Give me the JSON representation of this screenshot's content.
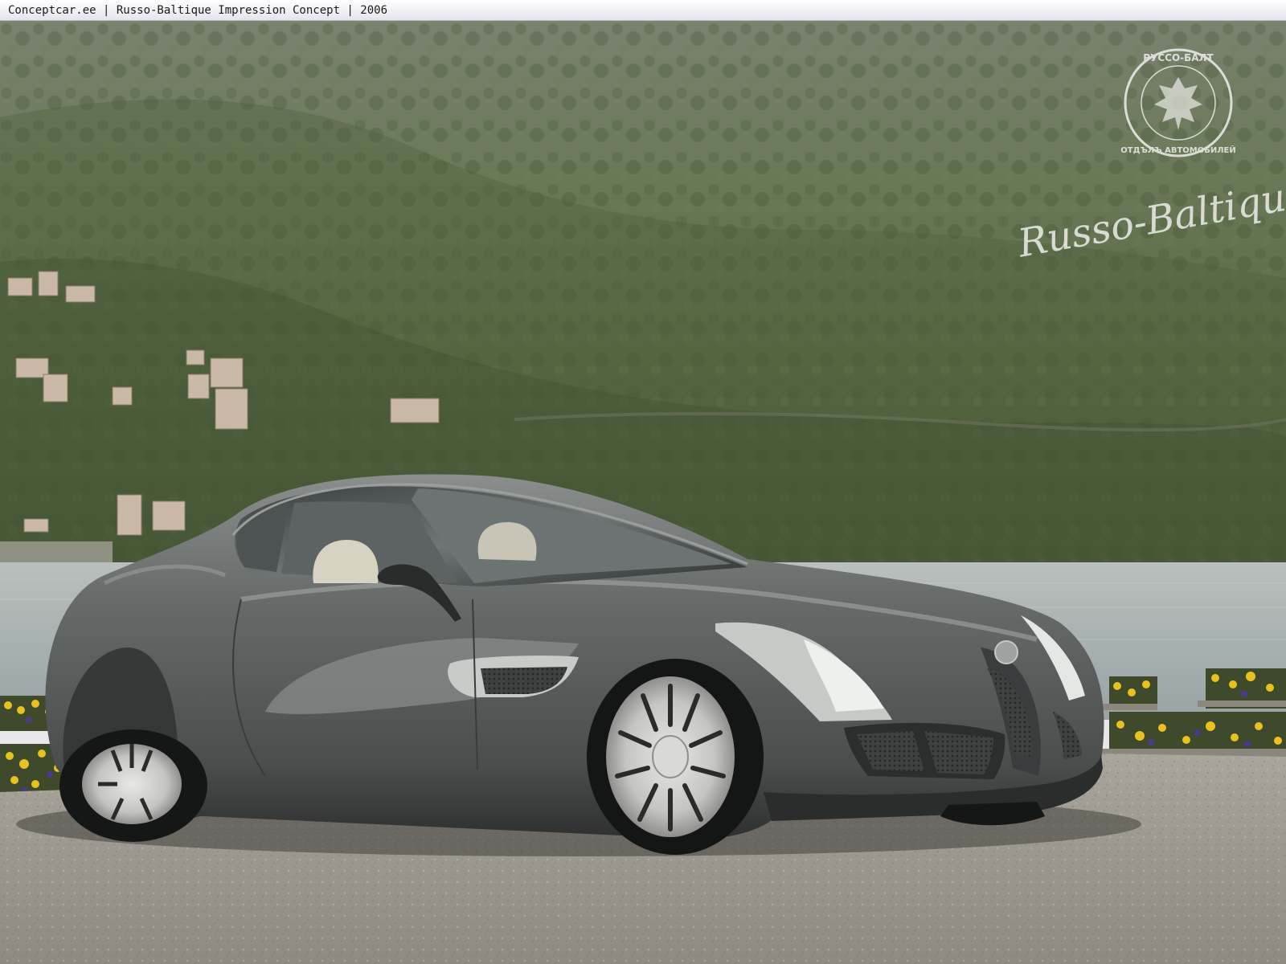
{
  "window": {
    "title": "Conceptcar.ee | Russo-Baltique Impression Concept | 2006"
  },
  "watermark": {
    "seal_top": "РУССО-БАЛТ",
    "seal_bottom": "ОТДЪЛЪ АВТОМОБИЛЕЙ",
    "script": "Russo-Baltique"
  },
  "colors": {
    "hillside": "#5e7048",
    "lake": "#a8b2b2",
    "gravel": "#9b968d",
    "car_body": "#5d605f",
    "flowers": "#e8c21e",
    "watermark": "#ffffff"
  },
  "icons": {
    "seal": "imperial-eagle-seal-icon"
  }
}
